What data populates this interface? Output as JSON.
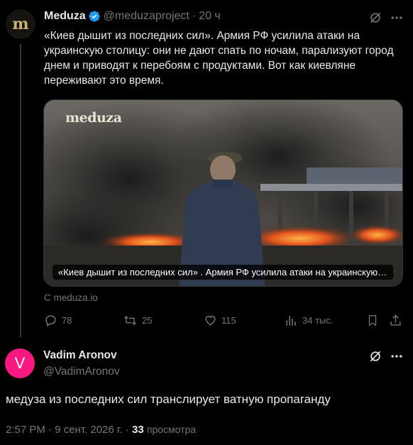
{
  "tweet": {
    "avatar_letter": "m",
    "author_name": "Meduza",
    "handle": "@meduzaproject",
    "separator": "·",
    "time": "20 ч",
    "text": "«Киев дышит из последних сил». Армия РФ усилила атаки на украинскую столицу: они не дают спать по ночам, парализуют город днем и приводят к перебоям с продуктами. Вот как киевляне переживают это время.",
    "card": {
      "logo": "meduza",
      "caption": "«Киев дышит из последних сил» . Армия РФ усилила атаки на украинскую столицу"
    },
    "source": "С meduza.io",
    "actions": {
      "replies": "78",
      "reposts": "25",
      "likes": "115",
      "views": "34 тыс."
    }
  },
  "reply": {
    "avatar_letter": "V",
    "author_name": "Vadim Aronov",
    "handle": "@VadimAronov",
    "text": "медуза из последних сил транслирует ватную пропаганду",
    "timestamp": "2:57 PM · 9 сент. 2026 г. · ",
    "views_count": "33",
    "views_label": "просмотра"
  },
  "colors": {
    "background": "#000000",
    "text_primary": "#e7e9ea",
    "text_secondary": "#71767b",
    "verified_blue": "#1d9bf0",
    "reply_avatar": "#f91880"
  },
  "icons": [
    "verified-badge-icon",
    "grok-icon",
    "more-icon",
    "reply-icon",
    "repost-icon",
    "like-icon",
    "views-icon",
    "bookmark-icon",
    "share-icon"
  ]
}
